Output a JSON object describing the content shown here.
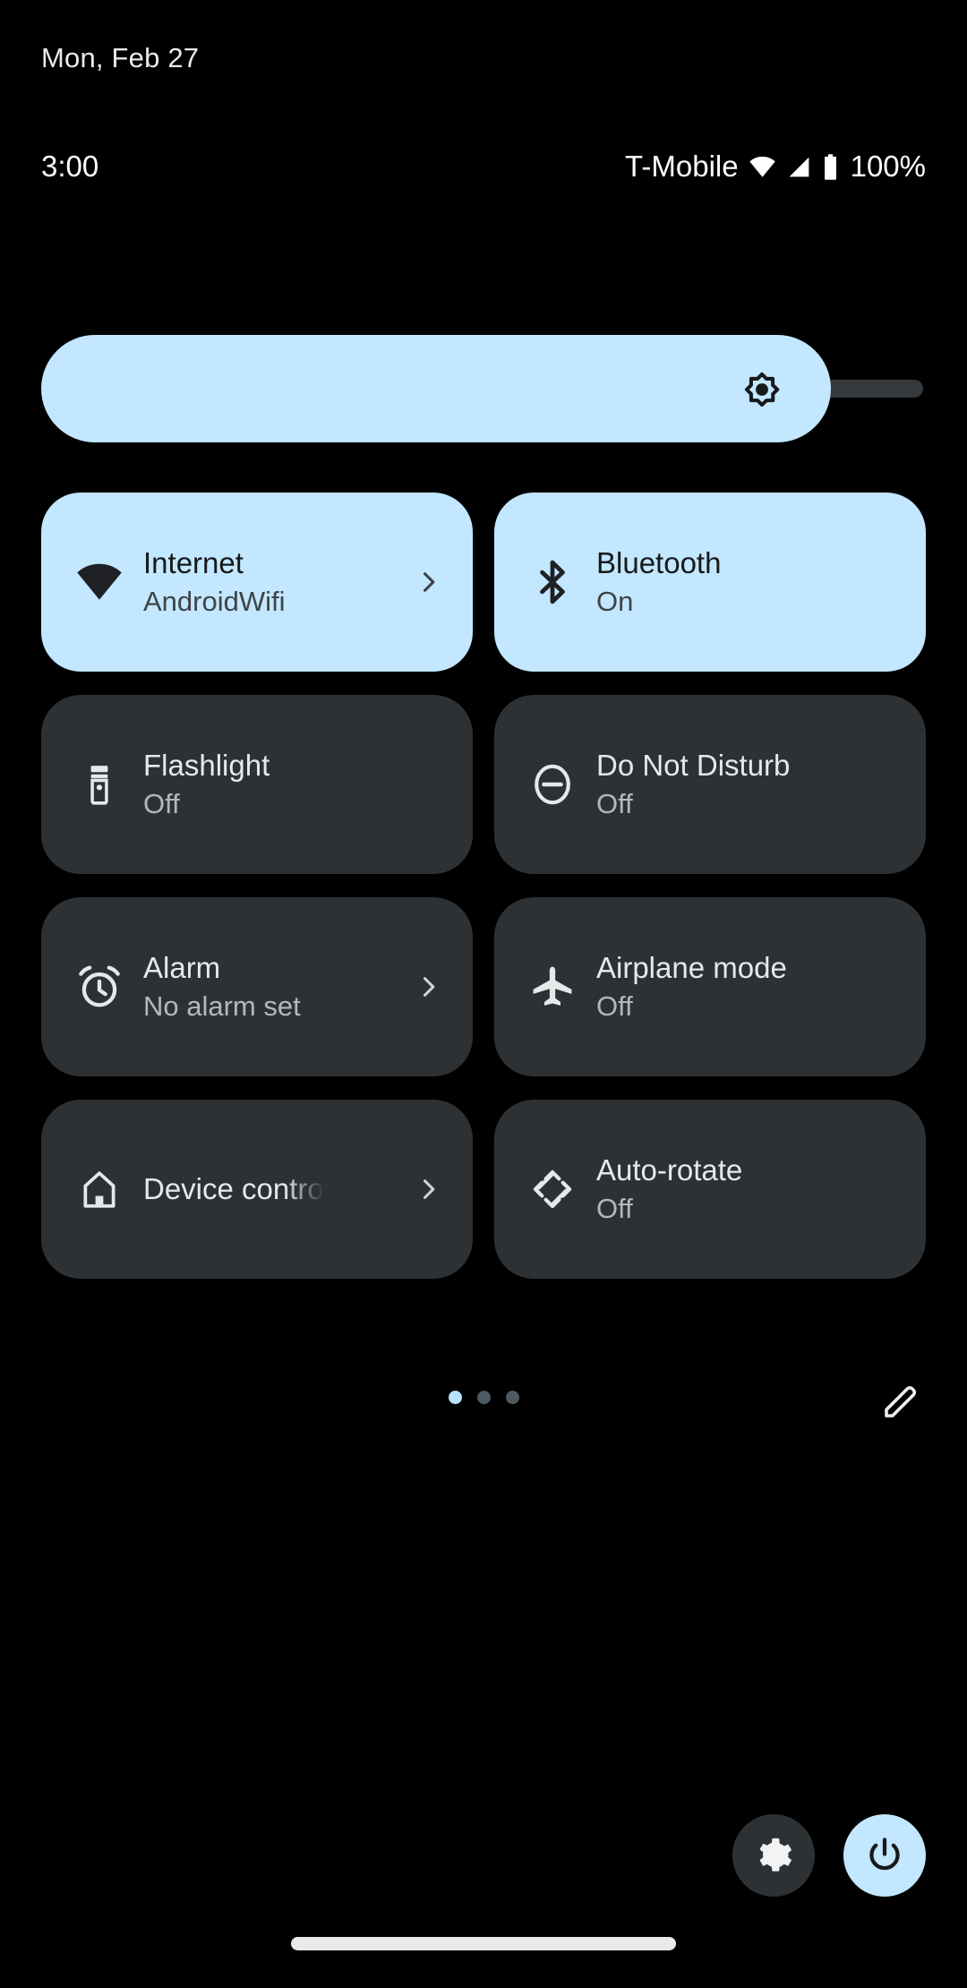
{
  "header": {
    "date": "Mon, Feb 27"
  },
  "status_bar": {
    "time": "3:00",
    "carrier": "T-Mobile",
    "battery_percent": "100%",
    "icons": [
      "wifi-icon",
      "signal-icon",
      "battery-icon"
    ]
  },
  "brightness": {
    "name": "brightness-slider",
    "icon": "brightness-icon",
    "fill_percent": 89
  },
  "tiles": [
    {
      "id": "internet",
      "icon": "wifi-icon",
      "title": "Internet",
      "subtitle": "AndroidWifi",
      "active": true,
      "chevron": true,
      "truncate": false
    },
    {
      "id": "bluetooth",
      "icon": "bluetooth-icon",
      "title": "Bluetooth",
      "subtitle": "On",
      "active": true,
      "chevron": false,
      "truncate": false
    },
    {
      "id": "flashlight",
      "icon": "flashlight-icon",
      "title": "Flashlight",
      "subtitle": "Off",
      "active": false,
      "chevron": false,
      "truncate": false
    },
    {
      "id": "do-not-disturb",
      "icon": "do-not-disturb-icon",
      "title": "Do Not Disturb",
      "subtitle": "Off",
      "active": false,
      "chevron": false,
      "truncate": false
    },
    {
      "id": "alarm",
      "icon": "alarm-clock-icon",
      "title": "Alarm",
      "subtitle": "No alarm set",
      "active": false,
      "chevron": true,
      "truncate": false
    },
    {
      "id": "airplane-mode",
      "icon": "airplane-icon",
      "title": "Airplane mode",
      "subtitle": "Off",
      "active": false,
      "chevron": false,
      "truncate": false
    },
    {
      "id": "device-controls",
      "icon": "home-icon",
      "title": "Device contro",
      "subtitle": "",
      "active": false,
      "chevron": true,
      "truncate": true
    },
    {
      "id": "auto-rotate",
      "icon": "auto-rotate-icon",
      "title": "Auto-rotate",
      "subtitle": "Off",
      "active": false,
      "chevron": false,
      "truncate": false
    }
  ],
  "pager": {
    "total_pages": 3,
    "active_page": 1,
    "edit_icon": "pencil-icon"
  },
  "bottom_buttons": [
    {
      "id": "settings",
      "icon": "gear-icon",
      "active": false
    },
    {
      "id": "power",
      "icon": "power-icon",
      "active": true
    }
  ],
  "nav": {
    "gesture_pill": "home-gesture-pill"
  },
  "colors": {
    "background": "#000000",
    "tile_active": "#c2e7ff",
    "tile_inactive": "#2e3134",
    "text_primary": "#e6e9ea",
    "text_secondary": "#b3b8bb",
    "text_on_active": "#17191a",
    "dot_active": "#b8e2fb",
    "dot_inactive": "#4d5a63"
  }
}
